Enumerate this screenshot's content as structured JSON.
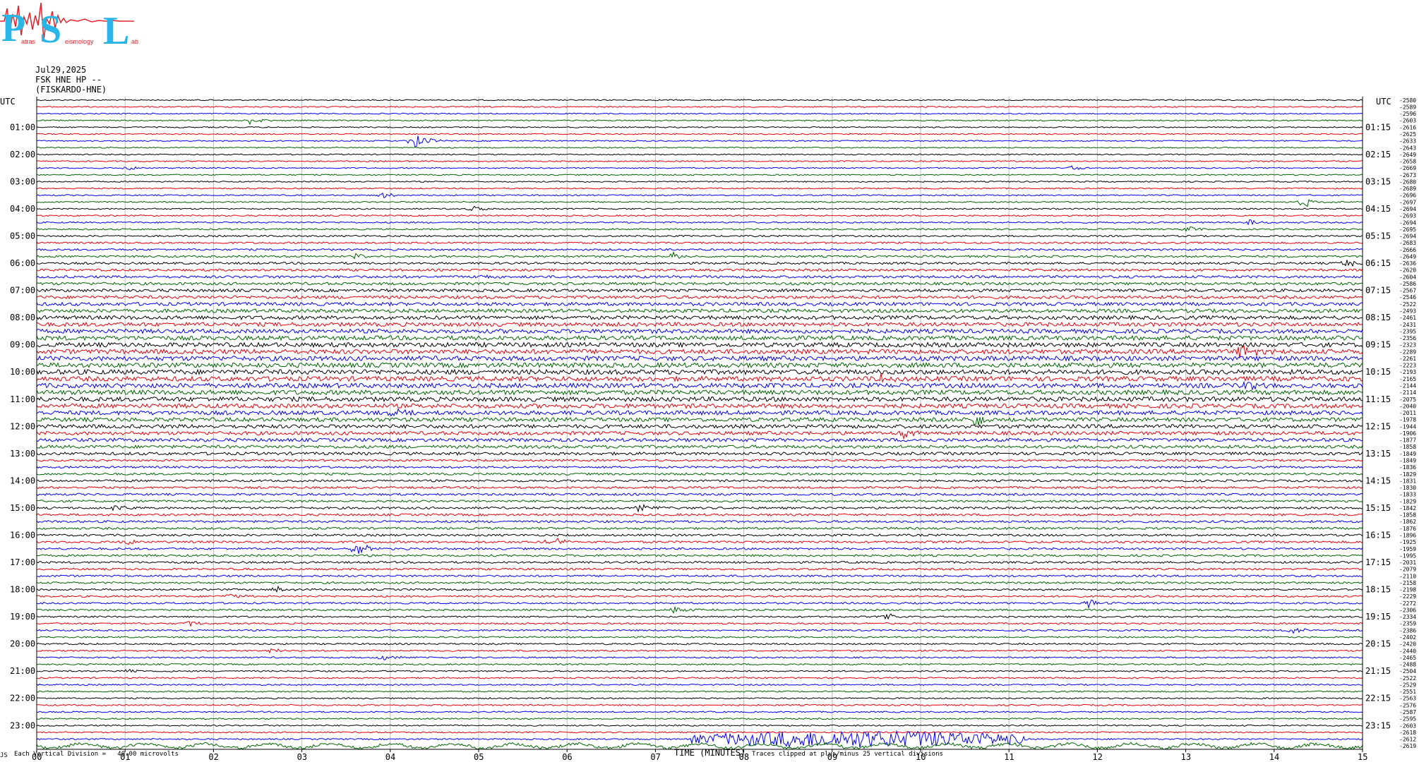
{
  "logo": {
    "letters": [
      "P",
      "S",
      "L"
    ],
    "subtext_1": "atras",
    "subtext_2": "eismology",
    "subtext_3": "ab",
    "color_letters": "#29b6e6",
    "color_wave": "#e8202a"
  },
  "header": {
    "date": "Jul29,2025",
    "station": "FSK HNE HP --",
    "name": "(FISKARDO-HNE)"
  },
  "footer": {
    "division_note": "Each Vertical Division =   40.00 microvolts",
    "clip_note": "Traces clipped at plus/minus 25 vertical divisions",
    "corner_mark": "JS"
  },
  "chart_data": {
    "type": "line",
    "title": "",
    "xlabel": "TIME (MINUTES)",
    "ylabel_left": "UTC",
    "ylabel_right": "UTC",
    "xlim": [
      0,
      15
    ],
    "x_ticks": [
      "00",
      "01",
      "02",
      "03",
      "04",
      "05",
      "06",
      "07",
      "08",
      "09",
      "10",
      "11",
      "12",
      "13",
      "14",
      "15"
    ],
    "left_time_labels": [
      "01:00",
      "02:00",
      "03:00",
      "04:00",
      "05:00",
      "06:00",
      "07:00",
      "08:00",
      "09:00",
      "10:00",
      "11:00",
      "12:00",
      "13:00",
      "14:00",
      "15:00",
      "16:00",
      "17:00",
      "18:00",
      "19:00",
      "20:00",
      "21:00",
      "22:00",
      "23:00"
    ],
    "right_time_labels": [
      "01:15",
      "02:15",
      "03:15",
      "04:15",
      "05:15",
      "06:15",
      "07:15",
      "08:15",
      "09:15",
      "10:15",
      "11:15",
      "12:15",
      "13:15",
      "14:15",
      "15:15",
      "16:15",
      "17:15",
      "18:15",
      "19:15",
      "20:15",
      "21:15",
      "22:15",
      "23:15"
    ],
    "trace_colors": [
      "#000000",
      "#e8000b",
      "#0000ff",
      "#006400"
    ],
    "trace_count": 96,
    "grid": "vertical-per-minute",
    "offsets": [
      "-2580",
      "-2589",
      "-2596",
      "-2603",
      "-2616",
      "-2625",
      "-2633",
      "-2643",
      "-2649",
      "-2658",
      "-2669",
      "-2673",
      "-2680",
      "-2689",
      "-2696",
      "-2697",
      "-2694",
      "-2693",
      "-2694",
      "-2695",
      "-2694",
      "-2683",
      "-2666",
      "-2649",
      "-2636",
      "-2620",
      "-2604",
      "-2586",
      "-2567",
      "-2546",
      "-2522",
      "-2493",
      "-2461",
      "-2431",
      "-2395",
      "-2356",
      "-2323",
      "-2289",
      "-2261",
      "-2223",
      "-2193",
      "-2165",
      "-2144",
      "-2114",
      "-2075",
      "-2040",
      "-2011",
      "-1978",
      "-1944",
      "-1906",
      "-1877",
      "-1858",
      "-1849",
      "-1849",
      "-1836",
      "-1829",
      "-1831",
      "-1830",
      "-1833",
      "-1829",
      "-1842",
      "-1858",
      "-1862",
      "-1876",
      "-1896",
      "-1925",
      "-1959",
      "-1995",
      "-2031",
      "-2079",
      "-2110",
      "-2158",
      "-2198",
      "-2229",
      "-2272",
      "-2306",
      "-2334",
      "-2359",
      "-2386",
      "-2402",
      "-2420",
      "-2440",
      "-2465",
      "-2488",
      "-2504",
      "-2522",
      "-2529",
      "-2551",
      "-2563",
      "-2576",
      "-2587",
      "-2595",
      "-2603",
      "-2618",
      "-2612",
      "-2619"
    ],
    "events": [
      {
        "trace": 3,
        "minute": 2.4,
        "amp": 6
      },
      {
        "trace": 6,
        "minute": 4.25,
        "amp": 14
      },
      {
        "trace": 10,
        "minute": 1.0,
        "amp": 4
      },
      {
        "trace": 10,
        "minute": 11.7,
        "amp": 4
      },
      {
        "trace": 14,
        "minute": 3.9,
        "amp": 4
      },
      {
        "trace": 15,
        "minute": 14.3,
        "amp": 10
      },
      {
        "trace": 16,
        "minute": 4.9,
        "amp": 5
      },
      {
        "trace": 18,
        "minute": 13.7,
        "amp": 5
      },
      {
        "trace": 19,
        "minute": 13.0,
        "amp": 6
      },
      {
        "trace": 23,
        "minute": 3.6,
        "amp": 5
      },
      {
        "trace": 23,
        "minute": 7.2,
        "amp": 6
      },
      {
        "trace": 24,
        "minute": 14.8,
        "amp": 6
      },
      {
        "trace": 26,
        "minute": 4.9,
        "amp": 6
      },
      {
        "trace": 37,
        "minute": 13.6,
        "amp": 14
      },
      {
        "trace": 41,
        "minute": 9.5,
        "amp": 7
      },
      {
        "trace": 42,
        "minute": 13.6,
        "amp": 10
      },
      {
        "trace": 46,
        "minute": 4.0,
        "amp": 6
      },
      {
        "trace": 47,
        "minute": 10.6,
        "amp": 14
      },
      {
        "trace": 49,
        "minute": 9.8,
        "amp": 6
      },
      {
        "trace": 60,
        "minute": 0.9,
        "amp": 6
      },
      {
        "trace": 60,
        "minute": 6.8,
        "amp": 6
      },
      {
        "trace": 65,
        "minute": 5.8,
        "amp": 10
      },
      {
        "trace": 65,
        "minute": 1.0,
        "amp": 5
      },
      {
        "trace": 66,
        "minute": 3.6,
        "amp": 12
      },
      {
        "trace": 72,
        "minute": 2.7,
        "amp": 5
      },
      {
        "trace": 73,
        "minute": 2.15,
        "amp": 6
      },
      {
        "trace": 74,
        "minute": 11.9,
        "amp": 6
      },
      {
        "trace": 75,
        "minute": 7.2,
        "amp": 6
      },
      {
        "trace": 76,
        "minute": 9.6,
        "amp": 5
      },
      {
        "trace": 77,
        "minute": 1.7,
        "amp": 5
      },
      {
        "trace": 78,
        "minute": 14.2,
        "amp": 6
      },
      {
        "trace": 81,
        "minute": 2.6,
        "amp": 5
      },
      {
        "trace": 82,
        "minute": 3.9,
        "amp": 6
      },
      {
        "trace": 84,
        "minute": 1.0,
        "amp": 4
      }
    ],
    "final_trace_burst": {
      "trace": 94,
      "start_minute": 7.4,
      "end_minute": 11.2,
      "amp": 12
    }
  }
}
